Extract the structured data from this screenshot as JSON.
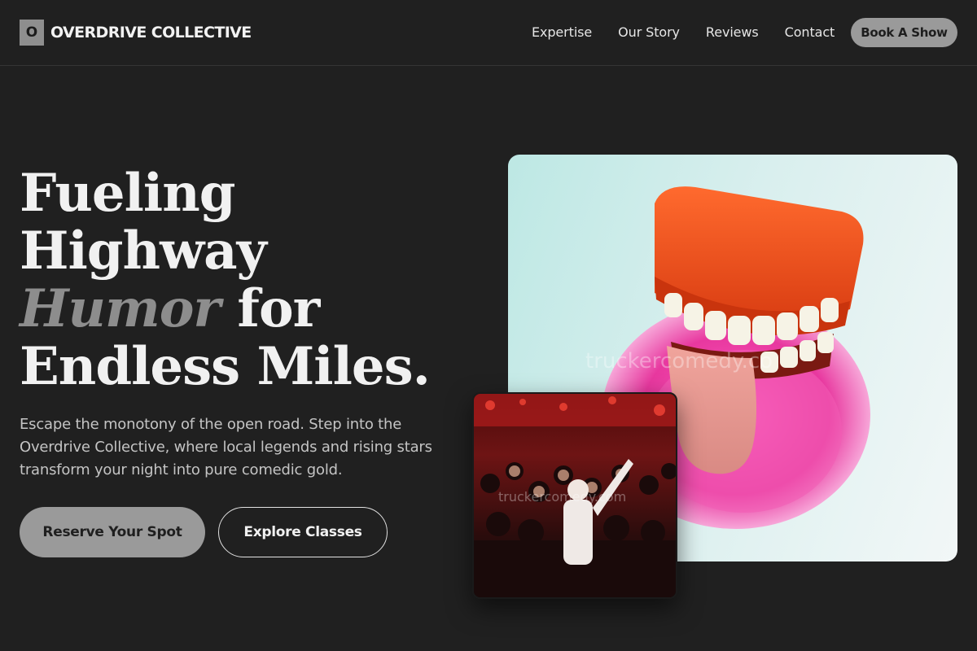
{
  "brand": {
    "mark": "O",
    "name": "OVERDRIVE COLLECTIVE"
  },
  "nav": {
    "links": [
      "Expertise",
      "Our Story",
      "Reviews",
      "Contact"
    ],
    "cta": "Book A Show"
  },
  "hero": {
    "title_line1": "Fueling",
    "title_line2": "Highway",
    "title_accent": "Humor",
    "title_line3_rest": " for",
    "title_line4": "Endless Miles.",
    "subtitle": "Escape the monotony of the open road. Step into the Overdrive Collective, where local legends and rising stars transform your night into pure comedic gold.",
    "primary_button": "Reserve Your Spot",
    "secondary_button": "Explore Classes"
  },
  "images": {
    "main_watermark": "truckercomedy.co",
    "small_watermark": "truckercomedy.com"
  },
  "colors": {
    "background": "#202020",
    "accent_gray": "#9a9a9a",
    "text": "#ececec"
  }
}
